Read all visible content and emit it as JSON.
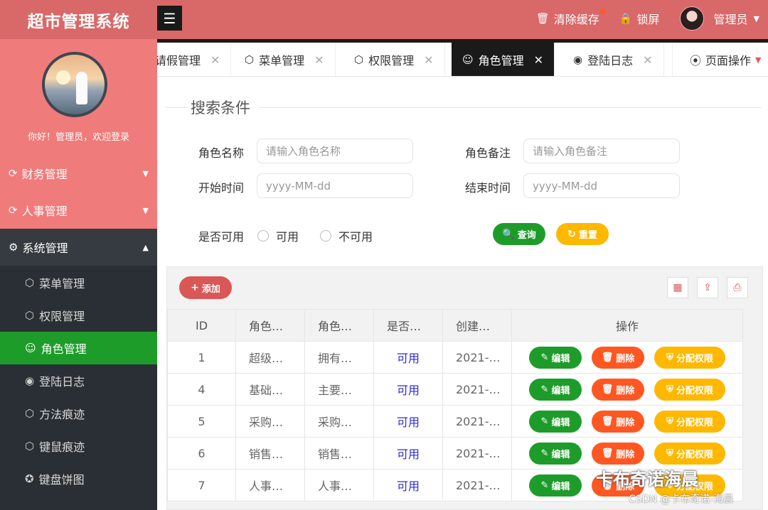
{
  "app": {
    "title": "超市管理系统",
    "menu_toggle_icon": "hamburger-icon"
  },
  "header": {
    "clear_cache": "清除缓存",
    "lock_screen": "锁屏",
    "user": "管理员"
  },
  "profile": {
    "welcome": "你好！管理员，欢迎登录"
  },
  "sidebar": {
    "groups": [
      {
        "label": "财务管理",
        "icon": "finance-icon"
      },
      {
        "label": "人事管理",
        "icon": "personnel-icon"
      },
      {
        "label": "系统管理",
        "icon": "gear-icon"
      }
    ],
    "items": [
      {
        "label": "菜单管理",
        "icon": "cube-icon"
      },
      {
        "label": "权限管理",
        "icon": "cube-icon"
      },
      {
        "label": "角色管理",
        "icon": "smile-icon"
      },
      {
        "label": "登陆日志",
        "icon": "weibo-icon"
      },
      {
        "label": "方法痕迹",
        "icon": "cube-icon"
      },
      {
        "label": "键鼠痕迹",
        "icon": "cube-icon"
      },
      {
        "label": "键盘饼图",
        "icon": "compass-icon"
      }
    ]
  },
  "tabs": [
    {
      "label": "请假管理"
    },
    {
      "label": "菜单管理"
    },
    {
      "label": "权限管理"
    },
    {
      "label": "角色管理"
    },
    {
      "label": "登陆日志"
    }
  ],
  "tab_ops": "页面操作",
  "search": {
    "title": "搜索条件",
    "role_name_label": "角色名称",
    "role_name_placeholder": "请输入角色名称",
    "role_note_label": "角色备注",
    "role_note_placeholder": "请输入角色备注",
    "start_label": "开始时间",
    "start_placeholder": "yyyy-MM-dd",
    "end_label": "结束时间",
    "end_placeholder": "yyyy-MM-dd",
    "enabled_label": "是否可用",
    "opt_yes": "可用",
    "opt_no": "不可用",
    "query_btn": "查询",
    "reset_btn": "重置"
  },
  "table": {
    "add_btn": "添加",
    "columns": [
      "ID",
      "角色…",
      "角色…",
      "是否…",
      "创建…",
      "操作"
    ],
    "rows": [
      {
        "id": "1",
        "name": "超级…",
        "note": "拥有…",
        "enabled": "可用",
        "created": "2021-…"
      },
      {
        "id": "4",
        "name": "基础…",
        "note": "主要…",
        "enabled": "可用",
        "created": "2021-…"
      },
      {
        "id": "5",
        "name": "采购…",
        "note": "采购…",
        "enabled": "可用",
        "created": "2021-…"
      },
      {
        "id": "6",
        "name": "销售…",
        "note": "销售…",
        "enabled": "可用",
        "created": "2021-…"
      },
      {
        "id": "7",
        "name": "人事…",
        "note": "人事…",
        "enabled": "可用",
        "created": "2021-…"
      }
    ],
    "edit": "编辑",
    "delete": "删除",
    "assign": "分配权限"
  },
  "watermark": {
    "brand": "卡布奇诺海晨",
    "csdn": "CSDN @卡布奇诺-海晨"
  },
  "colors": {
    "header": "#d96868",
    "sidebar": "#2a2f35",
    "active": "#1e9c2a",
    "yellow": "#ffb800",
    "orange": "#ff5722"
  }
}
